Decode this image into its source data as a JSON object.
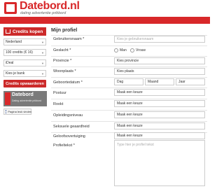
{
  "header": {
    "logo_text": "Datebord.nl",
    "tagline": "dating advertentie prikbord"
  },
  "sidebar": {
    "credits_title": "Credits kopen",
    "country": "Nederland",
    "credits_amount": "100 credits (€ 16)",
    "payment_method": "iDeal",
    "bank": "Kies je bank",
    "button": "Credits opwaarderen"
  },
  "facebook": {
    "title": "Datebord",
    "subtitle": "Dating advertentie prikbord",
    "like": "Pagina leuk vinden"
  },
  "form": {
    "title": "Mijn profiel",
    "fields": {
      "username": {
        "label": "Gebruikersnaam *",
        "placeholder": "Kies je gebruikersnaam"
      },
      "gender": {
        "label": "Geslacht *",
        "options": [
          "Man",
          "Vrouw"
        ]
      },
      "province": {
        "label": "Provincie *",
        "value": "Kies provincie"
      },
      "city": {
        "label": "Woonplaats *",
        "value": "Kies plaats"
      },
      "birthdate": {
        "label": "Geboortedatum *",
        "day": "Dag",
        "month": "Maand",
        "year": "Jaar"
      },
      "stature": {
        "label": "Postuur",
        "value": "Maak een keuze"
      },
      "smoking": {
        "label": "Rookt",
        "value": "Maak een keuze"
      },
      "education": {
        "label": "Opleidingsniveau",
        "value": "Maak een keuze"
      },
      "orientation": {
        "label": "Seksuele geaardheid",
        "value": "Maak een keuze"
      },
      "religion": {
        "label": "Geloofsovertuiging",
        "value": "Maak een keuze"
      },
      "profile_text": {
        "label": "Profieltekst *",
        "placeholder": "Type hier je profiel tekst"
      }
    }
  },
  "colors": {
    "brand_red": "#d8282a",
    "button_red": "#cc2a2a"
  }
}
